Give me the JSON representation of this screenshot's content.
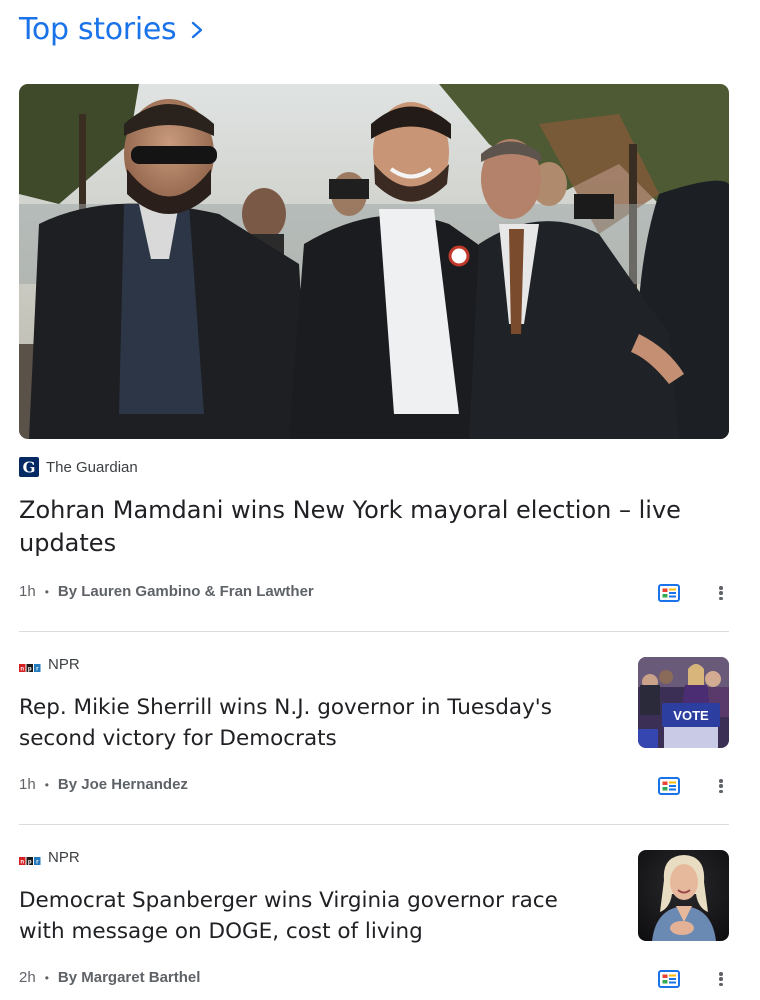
{
  "section": {
    "title": "Top stories",
    "chevron_icon": "chevron-right-icon",
    "title_color": "#1a73e8"
  },
  "stories": [
    {
      "source": "The Guardian",
      "source_logo": "guardian-logo",
      "headline": "Zohran Mamdani wins New York mayoral election – live updates",
      "time": "1h",
      "byline": "By Lauren Gambino & Fran Lawther",
      "image": "photo-crowd-walking"
    },
    {
      "source": "NPR",
      "source_logo": "npr-logo",
      "headline": "Rep. Mikie Sherrill wins N.J. governor in Tuesday's second victory for Democrats",
      "time": "1h",
      "byline": "By Joe Hernandez",
      "image": "photo-vote-rally",
      "thumb_sign_text": "VOTE"
    },
    {
      "source": "NPR",
      "source_logo": "npr-logo",
      "headline": "Democrat Spanberger wins Virginia governor race with message on DOGE, cost of living",
      "time": "2h",
      "byline": "By Margaret Barthel",
      "image": "photo-speaker-portrait"
    }
  ],
  "icons": {
    "full_coverage": "full-coverage-icon",
    "more": "more-vert-icon"
  },
  "colors": {
    "divider": "#dadce0",
    "meta_text": "#5f6368",
    "headline_text": "#202124"
  }
}
